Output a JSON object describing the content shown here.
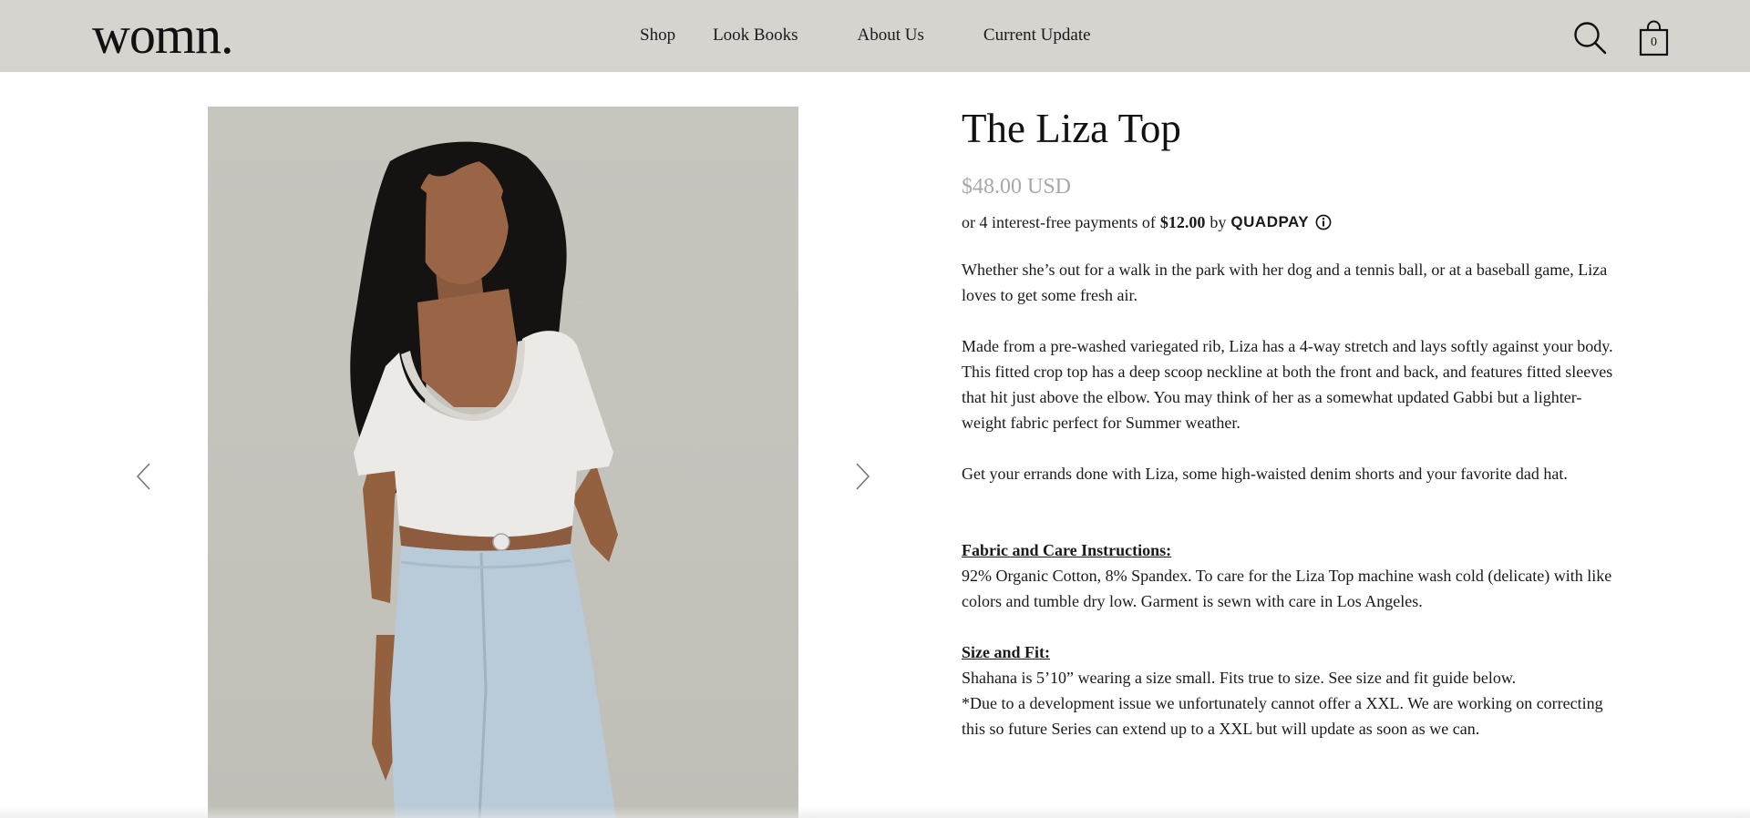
{
  "header": {
    "logo": "womn.",
    "nav": [
      "Shop",
      "Look Books",
      "About Us",
      "Current Update"
    ],
    "icons": {
      "search": "search-icon",
      "cart": "shopping-bag-icon"
    },
    "cart_count": "0"
  },
  "gallery": {
    "image_alt": "Model wearing white scoop-neck crop top and light-wash high-waisted jeans",
    "prev_icon": "chevron-left-icon",
    "next_icon": "chevron-right-icon"
  },
  "product": {
    "title": "The Liza Top",
    "price": "$48.00 USD",
    "installments": {
      "prefix": "or 4 interest-free payments of",
      "amount": "$12.00",
      "by": "by",
      "provider": "QUADPAY",
      "info_icon": "info-icon"
    },
    "description": [
      "Whether she’s out for a walk in the park with her dog and a tennis ball, or at a baseball game, Liza loves to get some fresh air.",
      "Made from a pre-washed variegated rib, Liza has a 4-way stretch and lays softly against your body. This fitted crop top has a deep scoop neckline at both the front and back, and features fitted sleeves that hit just above the elbow. You may think of her as a somewhat updated Gabbi but a lighter-weight fabric perfect for Summer weather.",
      "Get your errands done with Liza, some high-waisted denim shorts and your favorite dad hat."
    ],
    "care": {
      "heading": "Fabric and Care Instructions:",
      "text": "92% Organic Cotton, 8% Spandex. To care for the Liza Top machine wash cold (delicate) with like colors and tumble dry low. Garment is sewn with care in Los Angeles."
    },
    "size": {
      "heading": "Size and Fit:",
      "line1": "Shahana is 5’10” wearing a size small. Fits true to size. See size and fit guide below.",
      "line2": "*Due to a development issue we unfortunately cannot offer a XXL. We are working on correcting this so future Series can extend up to a XXL but will update as soon as we can."
    }
  }
}
